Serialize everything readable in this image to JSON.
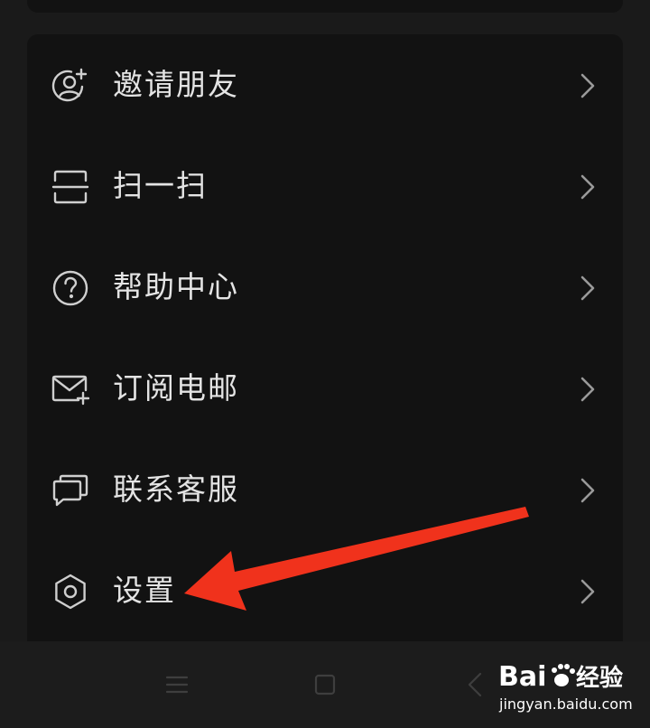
{
  "menu": {
    "items": [
      {
        "label": "邀请朋友",
        "icon": "invite-friend-icon"
      },
      {
        "label": "扫一扫",
        "icon": "scan-icon"
      },
      {
        "label": "帮助中心",
        "icon": "help-icon"
      },
      {
        "label": "订阅电邮",
        "icon": "subscribe-mail-icon"
      },
      {
        "label": "联系客服",
        "icon": "customer-service-icon"
      },
      {
        "label": "设置",
        "icon": "gear-icon"
      }
    ]
  },
  "navigation_bar": {
    "buttons": [
      "menu-icon",
      "home-square-icon",
      "back-icon"
    ]
  },
  "watermark": {
    "brand": "Bai",
    "brand_suffix": "经验",
    "url": "jingyan.baidu.com"
  },
  "colors": {
    "background": "#1a1a1a",
    "card": "#121212",
    "text": "#e4e4e4",
    "icon": "#cfcfcf",
    "annotation_arrow": "#f0321c"
  }
}
